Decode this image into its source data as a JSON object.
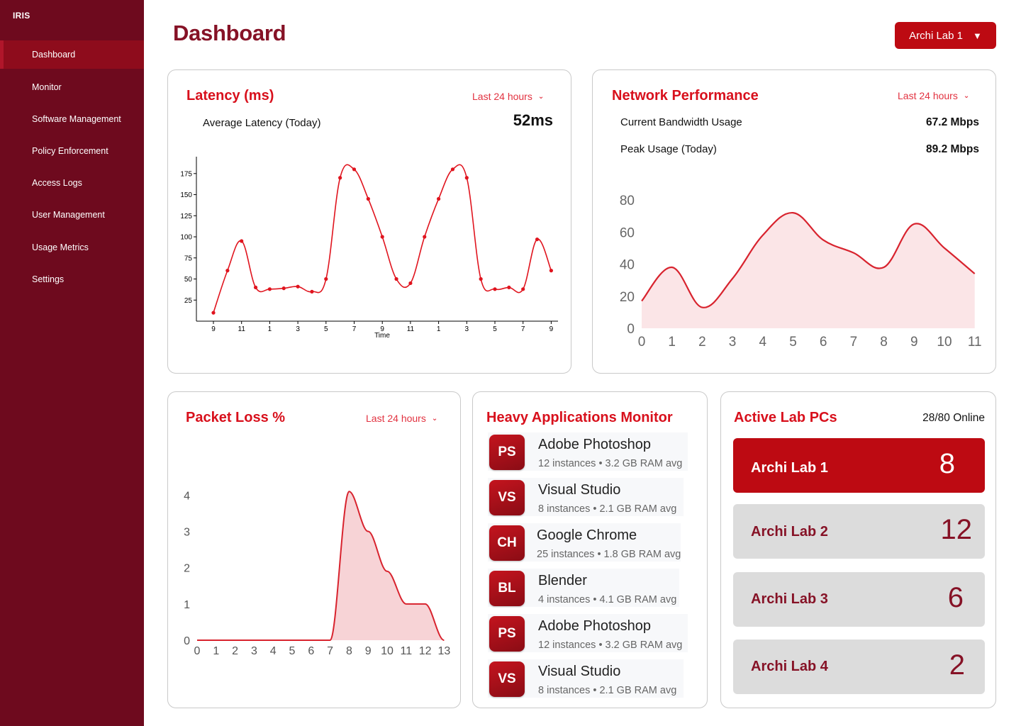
{
  "app": {
    "brand": "IRIS"
  },
  "sidebar": {
    "items": [
      {
        "label": "Dashboard",
        "active": true
      },
      {
        "label": "Monitor"
      },
      {
        "label": "Software Management"
      },
      {
        "label": "Policy Enforcement"
      },
      {
        "label": "Access Logs"
      },
      {
        "label": "User Management"
      },
      {
        "label": "Usage Metrics"
      },
      {
        "label": "Settings"
      }
    ]
  },
  "header": {
    "title": "Dashboard",
    "lab_selector": "Archi Lab 1",
    "caret": "▼"
  },
  "colors": {
    "sidebar": "#6e0a1e",
    "accent": "#bd0a12",
    "title": "#861226",
    "card_title": "#d8101c"
  },
  "latency": {
    "title": "Latency (ms)",
    "range": "Last 24 hours",
    "avg_label": "Average Latency (Today)",
    "avg_value": "52ms"
  },
  "network": {
    "title": "Network Performance",
    "range": "Last 24 hours",
    "current_label": "Current Bandwidth Usage",
    "current_value": "67.2 Mbps",
    "peak_label": "Peak Usage (Today)",
    "peak_value": "89.2 Mbps"
  },
  "packet_loss": {
    "title": "Packet Loss %",
    "range": "Last 24 hours"
  },
  "heavy_apps": {
    "title": "Heavy Applications Monitor",
    "items": [
      {
        "badge": "PS",
        "name": "Adobe Photoshop",
        "meta": "12 instances • 3.2 GB RAM avg"
      },
      {
        "badge": "VS",
        "name": "Visual Studio",
        "meta": "8 instances • 2.1 GB RAM avg"
      },
      {
        "badge": "CH",
        "name": "Google Chrome",
        "meta": "25 instances • 1.8 GB RAM avg"
      },
      {
        "badge": "BL",
        "name": "Blender",
        "meta": "4 instances • 4.1 GB RAM avg"
      },
      {
        "badge": "PS",
        "name": "Adobe Photoshop",
        "meta": "12 instances • 3.2 GB RAM avg"
      },
      {
        "badge": "VS",
        "name": "Visual Studio",
        "meta": "8 instances • 2.1 GB RAM avg"
      }
    ]
  },
  "active_pcs": {
    "title": "Active Lab PCs",
    "online": "28/80 Online",
    "labs": [
      {
        "name": "Archi Lab 1",
        "count": "8",
        "active": true
      },
      {
        "name": "Archi Lab 2",
        "count": "12"
      },
      {
        "name": "Archi Lab 3",
        "count": "6"
      },
      {
        "name": "Archi Lab 4",
        "count": "2"
      }
    ]
  },
  "chart_data": [
    {
      "type": "line",
      "xlabel": "Time",
      "ylabel": "",
      "x": [
        0,
        1,
        2,
        3,
        4,
        5,
        6,
        7,
        8,
        9,
        10,
        11,
        12,
        13,
        14,
        15,
        16,
        17,
        18,
        19,
        20,
        21,
        22,
        23,
        24
      ],
      "x_tick_labels": [
        "9",
        "11",
        "1",
        "3",
        "5",
        "7",
        "9",
        "11",
        "1",
        "3",
        "5",
        "7",
        "9"
      ],
      "values": [
        10,
        60,
        95,
        40,
        38,
        39,
        41,
        35,
        50,
        170,
        180,
        145,
        100,
        50,
        45,
        100,
        145,
        180,
        170,
        50,
        38,
        40,
        38,
        97,
        60
      ],
      "ylim": [
        0,
        195
      ],
      "yticks": [
        25,
        50,
        75,
        100,
        125,
        150,
        175
      ],
      "grid": false
    },
    {
      "type": "area",
      "x": [
        0,
        1,
        2,
        3,
        4,
        5,
        6,
        7,
        8,
        9,
        10,
        11
      ],
      "values": [
        17,
        38,
        13,
        31,
        58,
        72,
        55,
        47,
        38,
        65,
        50,
        34
      ],
      "ylim": [
        0,
        80
      ],
      "yticks": [
        0,
        20,
        40,
        60,
        80
      ],
      "grid": false
    },
    {
      "type": "area",
      "x": [
        0,
        1,
        2,
        3,
        4,
        5,
        6,
        7,
        8,
        9,
        10,
        11,
        12,
        13
      ],
      "values": [
        0,
        0,
        0,
        0,
        0,
        0,
        0,
        0,
        4.1,
        3,
        1.9,
        1,
        1,
        0
      ],
      "ylim": [
        0,
        4.3
      ],
      "yticks": [
        0,
        1,
        2,
        3,
        4
      ],
      "grid": false
    }
  ]
}
